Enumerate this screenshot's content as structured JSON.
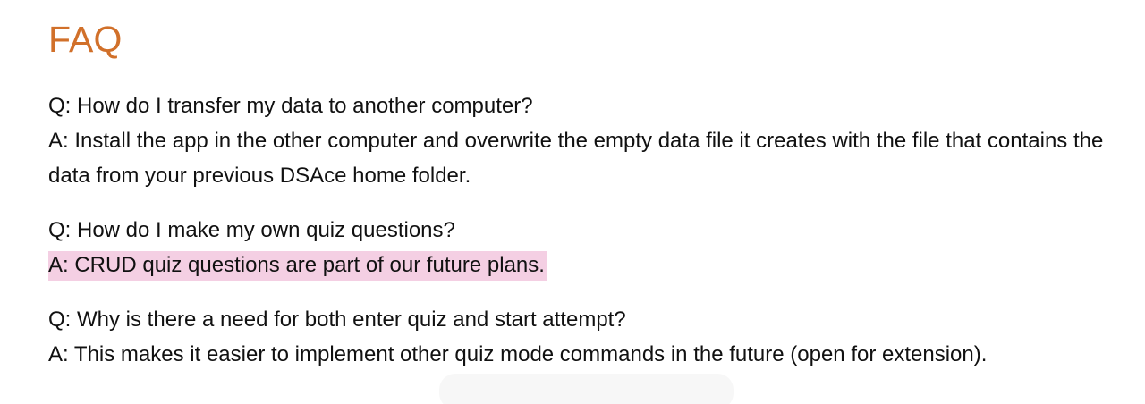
{
  "title": "FAQ",
  "colors": {
    "title": "#d1702a",
    "highlight": "#f4cfe3",
    "text": "#111111"
  },
  "faq": [
    {
      "question": "Q: How do I transfer my data to another computer?",
      "answer": "A: Install the app in the other computer and overwrite the empty data file it creates with the file that contains the data from your previous DSAce home folder."
    },
    {
      "question": "Q: How do I make my own quiz questions?",
      "answer": "A: CRUD quiz questions are part of our future plans."
    },
    {
      "question": "Q: Why is there a need for both enter quiz and start attempt?",
      "answer": "A: This makes it easier to implement other quiz mode commands in the future (open for extension)."
    }
  ]
}
